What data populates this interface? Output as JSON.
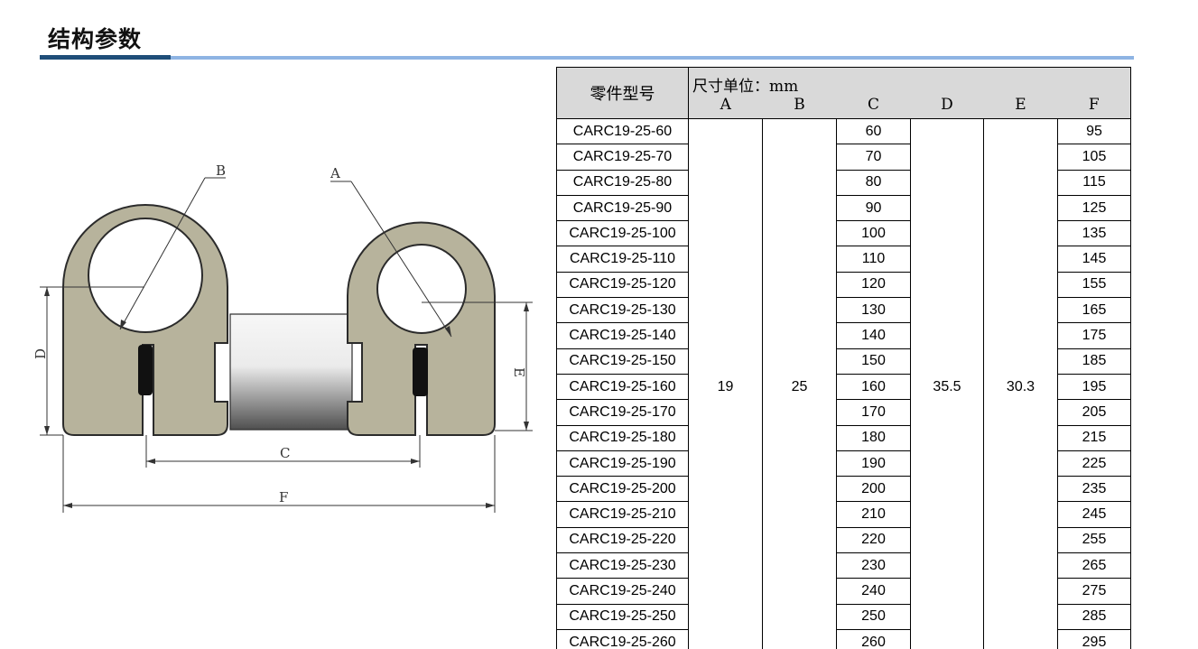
{
  "section_title": "结构参数",
  "drawing": {
    "dimension_labels": [
      "A",
      "B",
      "C",
      "D",
      "E",
      "F"
    ],
    "colors": {
      "clamp_fill": "#b7b39c",
      "clamp_stroke": "#2b2b2b",
      "rod_light": "#f4f4f4",
      "rod_dark": "#555555",
      "gasket": "#111111",
      "dim_line": "#333333"
    }
  },
  "table": {
    "header_part": "零件型号",
    "header_unit": "尺寸单位：mm",
    "columns": [
      "A",
      "B",
      "C",
      "D",
      "E",
      "F"
    ],
    "shared_values": {
      "A": "19",
      "B": "25",
      "D": "35.5",
      "E": "30.3"
    },
    "rows": [
      {
        "part": "CARC19-25-60",
        "C": "60",
        "F": "95"
      },
      {
        "part": "CARC19-25-70",
        "C": "70",
        "F": "105"
      },
      {
        "part": "CARC19-25-80",
        "C": "80",
        "F": "115"
      },
      {
        "part": "CARC19-25-90",
        "C": "90",
        "F": "125"
      },
      {
        "part": "CARC19-25-100",
        "C": "100",
        "F": "135"
      },
      {
        "part": "CARC19-25-110",
        "C": "110",
        "F": "145"
      },
      {
        "part": "CARC19-25-120",
        "C": "120",
        "F": "155"
      },
      {
        "part": "CARC19-25-130",
        "C": "130",
        "F": "165"
      },
      {
        "part": "CARC19-25-140",
        "C": "140",
        "F": "175"
      },
      {
        "part": "CARC19-25-150",
        "C": "150",
        "F": "185"
      },
      {
        "part": "CARC19-25-160",
        "C": "160",
        "F": "195"
      },
      {
        "part": "CARC19-25-170",
        "C": "170",
        "F": "205"
      },
      {
        "part": "CARC19-25-180",
        "C": "180",
        "F": "215"
      },
      {
        "part": "CARC19-25-190",
        "C": "190",
        "F": "225"
      },
      {
        "part": "CARC19-25-200",
        "C": "200",
        "F": "235"
      },
      {
        "part": "CARC19-25-210",
        "C": "210",
        "F": "245"
      },
      {
        "part": "CARC19-25-220",
        "C": "220",
        "F": "255"
      },
      {
        "part": "CARC19-25-230",
        "C": "230",
        "F": "265"
      },
      {
        "part": "CARC19-25-240",
        "C": "240",
        "F": "275"
      },
      {
        "part": "CARC19-25-250",
        "C": "250",
        "F": "285"
      },
      {
        "part": "CARC19-25-260",
        "C": "260",
        "F": "295"
      }
    ]
  },
  "colors": {
    "title_rule_dark": "#1f4e79",
    "title_rule_light": "#8eb4e3",
    "table_header_bg": "#d9d9d9"
  }
}
